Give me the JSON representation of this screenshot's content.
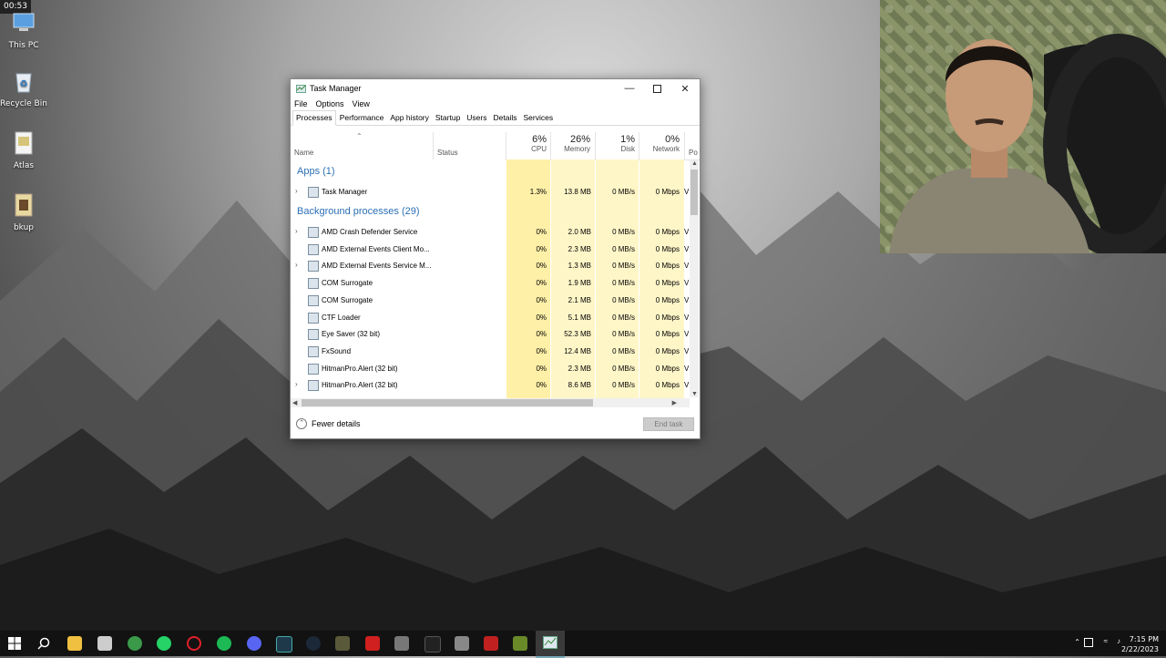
{
  "overlay": {
    "recording_time": "00:53"
  },
  "desktop": {
    "icons": [
      {
        "label": "This PC",
        "icon": "computer-icon"
      },
      {
        "label": "Recycle Bin",
        "icon": "recycle-bin-icon"
      },
      {
        "label": "Atlas",
        "icon": "folder-icon"
      },
      {
        "label": "bkup",
        "icon": "folder-icon"
      }
    ]
  },
  "task_manager": {
    "title": "Task Manager",
    "menu": [
      "File",
      "Options",
      "View"
    ],
    "tabs": [
      "Processes",
      "Performance",
      "App history",
      "Startup",
      "Users",
      "Details",
      "Services"
    ],
    "active_tab": "Processes",
    "columns": {
      "name": "Name",
      "status": "Status",
      "cpu": {
        "pct": "6%",
        "label": "CPU"
      },
      "memory": {
        "pct": "26%",
        "label": "Memory"
      },
      "disk": {
        "pct": "1%",
        "label": "Disk"
      },
      "network": {
        "pct": "0%",
        "label": "Network"
      },
      "power": "Po"
    },
    "groups": {
      "apps": "Apps (1)",
      "background": "Background processes (29)"
    },
    "apps": [
      {
        "name": "Task Manager",
        "cpu": "1.3%",
        "memory": "13.8 MB",
        "disk": "0 MB/s",
        "network": "0 Mbps",
        "power": "V",
        "expandable": true
      }
    ],
    "background": [
      {
        "name": "AMD Crash Defender Service",
        "cpu": "0%",
        "memory": "2.0 MB",
        "disk": "0 MB/s",
        "network": "0 Mbps",
        "power": "V",
        "expandable": true
      },
      {
        "name": "AMD External Events Client Mo...",
        "cpu": "0%",
        "memory": "2.3 MB",
        "disk": "0 MB/s",
        "network": "0 Mbps",
        "power": "V",
        "expandable": false
      },
      {
        "name": "AMD External Events Service M...",
        "cpu": "0%",
        "memory": "1.3 MB",
        "disk": "0 MB/s",
        "network": "0 Mbps",
        "power": "V",
        "expandable": true
      },
      {
        "name": "COM Surrogate",
        "cpu": "0%",
        "memory": "1.9 MB",
        "disk": "0 MB/s",
        "network": "0 Mbps",
        "power": "V",
        "expandable": false
      },
      {
        "name": "COM Surrogate",
        "cpu": "0%",
        "memory": "2.1 MB",
        "disk": "0 MB/s",
        "network": "0 Mbps",
        "power": "V",
        "expandable": false
      },
      {
        "name": "CTF Loader",
        "cpu": "0%",
        "memory": "5.1 MB",
        "disk": "0 MB/s",
        "network": "0 Mbps",
        "power": "V",
        "expandable": false
      },
      {
        "name": "Eye Saver (32 bit)",
        "cpu": "0%",
        "memory": "52.3 MB",
        "disk": "0 MB/s",
        "network": "0 Mbps",
        "power": "V",
        "expandable": false
      },
      {
        "name": "FxSound",
        "cpu": "0%",
        "memory": "12.4 MB",
        "disk": "0 MB/s",
        "network": "0 Mbps",
        "power": "V",
        "expandable": false
      },
      {
        "name": "HitmanPro.Alert (32 bit)",
        "cpu": "0%",
        "memory": "2.3 MB",
        "disk": "0 MB/s",
        "network": "0 Mbps",
        "power": "V",
        "expandable": false
      },
      {
        "name": "HitmanPro.Alert (32 bit)",
        "cpu": "0%",
        "memory": "8.6 MB",
        "disk": "0 MB/s",
        "network": "0 Mbps",
        "power": "V",
        "expandable": true
      }
    ],
    "footer": {
      "fewer_details": "Fewer details",
      "end_task": "End task"
    }
  },
  "taskbar": {
    "clock_time": "7:15 PM",
    "clock_date": "2/22/2023"
  },
  "colors": {
    "group_header": "#2a6fb5",
    "cpu_highlight": "#fff0a8",
    "column_highlight": "#fff6c8",
    "taskbar_bg": "#121212"
  }
}
